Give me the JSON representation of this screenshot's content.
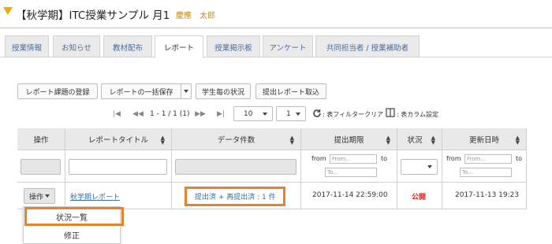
{
  "header": {
    "title": "【秋学期】ITC授業サンプル 月1",
    "user": "慶應　太郎"
  },
  "tabs": [
    {
      "label": "授業情報"
    },
    {
      "label": "お知らせ"
    },
    {
      "label": "教材配布"
    },
    {
      "label": "レポート",
      "active": true
    },
    {
      "label": "授業掲示板"
    },
    {
      "label": "アンケート"
    },
    {
      "label": "共同担当者 / 授業補助者"
    }
  ],
  "toolbar": {
    "register_label": "レポート課題の登録",
    "bulk_save_label": "レポートの一括保存",
    "per_student_label": "学生毎の状況",
    "import_label": "提出レポート取込"
  },
  "pager": {
    "range": "1 - 1 / 1 (1)",
    "page_size": "10",
    "page": "1",
    "clear_filter": ": 表フィルタークリア",
    "column_settings": ": 表カラム設定"
  },
  "table": {
    "headers": {
      "ops": "操作",
      "title": "レポートタイトル",
      "data_count": "データ件数",
      "deadline": "提出期限",
      "status": "状況",
      "updated": "更新日時"
    },
    "filter": {
      "from": "from",
      "to": "to",
      "from_placeholder": "From...",
      "to_placeholder": "To..."
    },
    "rows": [
      {
        "ops_label": "操作",
        "title": "秋学期レポート",
        "data_count": "提出済 + 再提出済 : 1 件",
        "deadline": "2017-11-14 22:59:00",
        "status": "公開",
        "updated": "2017-11-13 19:23"
      }
    ]
  },
  "dropdown": {
    "items": [
      "状況一覧",
      "修正"
    ]
  },
  "colors": {
    "accent": "#e8822a",
    "status_public": "#cc2222",
    "link": "#3a6ea5",
    "header_arrow": "#f2a900"
  }
}
